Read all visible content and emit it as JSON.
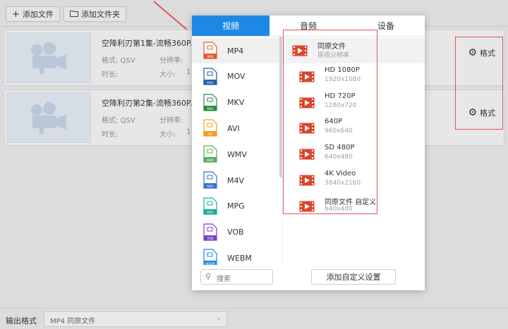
{
  "toolbar": {
    "add_file": "添加文件",
    "add_folder": "添加文件夹"
  },
  "files": [
    {
      "name": "空降利刃第1集-流畅360P.",
      "format_label": "格式: QSV",
      "resolution_label": "分辨率:",
      "duration_label": "时长:",
      "size_label": "大小:",
      "size_value": "1",
      "format_button": "格式"
    },
    {
      "name": "空降利刃第2集-流畅360P.",
      "format_label": "格式: QSV",
      "resolution_label": "分辨率:",
      "duration_label": "时长:",
      "size_label": "大小:",
      "size_value": "1",
      "format_button": "格式"
    }
  ],
  "popup": {
    "tabs": [
      "视频",
      "音频",
      "设备"
    ],
    "active_tab": 0,
    "formats": [
      {
        "label": "MP4",
        "color": "#e45a2a"
      },
      {
        "label": "MOV",
        "color": "#1f5fa8"
      },
      {
        "label": "MKV",
        "color": "#2e8b3d"
      },
      {
        "label": "AVI",
        "color": "#f29b20"
      },
      {
        "label": "WMV",
        "color": "#4caf50"
      },
      {
        "label": "M4V",
        "color": "#3b6fd1"
      },
      {
        "label": "MPG",
        "color": "#1ca89a"
      },
      {
        "label": "VOB",
        "color": "#7a3fc9"
      },
      {
        "label": "WEBM",
        "color": "#1e88e5"
      }
    ],
    "selected_format": 0,
    "presets": [
      {
        "name": "同原文件",
        "sub": "原视分辨率"
      },
      {
        "name": "HD 1080P",
        "sub": "1920x1080"
      },
      {
        "name": "HD 720P",
        "sub": "1280x720"
      },
      {
        "name": "640P",
        "sub": "960x640"
      },
      {
        "name": "SD 480P",
        "sub": "640x480"
      },
      {
        "name": "4K Video",
        "sub": "3840x2160"
      },
      {
        "name": "同原文件 自定义",
        "sub": "640x480"
      }
    ],
    "search_placeholder": "搜索",
    "add_custom": "添加自定义设置"
  },
  "bottom": {
    "label": "输出格式",
    "value": "MP4  同原文件"
  },
  "colors": {
    "accent": "#1e88e5",
    "annotation_red": "#e25555",
    "film_red": "#d9462b"
  }
}
